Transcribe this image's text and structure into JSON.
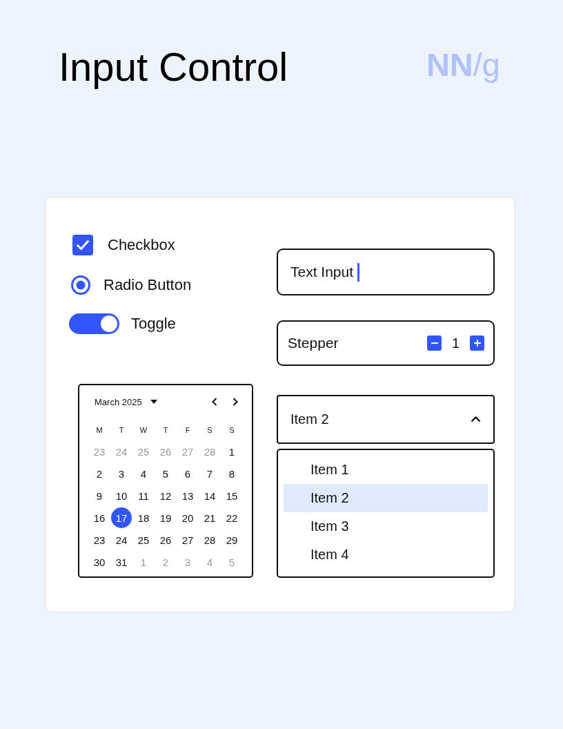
{
  "title": "Input Control",
  "logo": "**NN**/g",
  "checkbox": {
    "label": "Checkbox",
    "checked": true
  },
  "radio": {
    "label": "Radio Button",
    "selected": true
  },
  "toggle": {
    "label": "Toggle",
    "on": true
  },
  "calendar": {
    "month": "March 2025",
    "weekdays": [
      "M",
      "T",
      "W",
      "T",
      "F",
      "S",
      "S"
    ],
    "weeks": [
      [
        {
          "day": "23",
          "muted": true,
          "selected": false
        },
        {
          "day": "24",
          "muted": true,
          "selected": false
        },
        {
          "day": "25",
          "muted": true,
          "selected": false
        },
        {
          "day": "26",
          "muted": true,
          "selected": false
        },
        {
          "day": "27",
          "muted": true,
          "selected": false
        },
        {
          "day": "28",
          "muted": true,
          "selected": false
        },
        {
          "day": "1",
          "muted": false,
          "selected": false
        }
      ],
      [
        {
          "day": "2",
          "muted": false,
          "selected": false
        },
        {
          "day": "3",
          "muted": false,
          "selected": false
        },
        {
          "day": "4",
          "muted": false,
          "selected": false
        },
        {
          "day": "5",
          "muted": false,
          "selected": false
        },
        {
          "day": "6",
          "muted": false,
          "selected": false
        },
        {
          "day": "7",
          "muted": false,
          "selected": false
        },
        {
          "day": "8",
          "muted": false,
          "selected": false
        }
      ],
      [
        {
          "day": "9",
          "muted": false,
          "selected": false
        },
        {
          "day": "10",
          "muted": false,
          "selected": false
        },
        {
          "day": "11",
          "muted": false,
          "selected": false
        },
        {
          "day": "12",
          "muted": false,
          "selected": false
        },
        {
          "day": "13",
          "muted": false,
          "selected": false
        },
        {
          "day": "14",
          "muted": false,
          "selected": false
        },
        {
          "day": "15",
          "muted": false,
          "selected": false
        }
      ],
      [
        {
          "day": "16",
          "muted": false,
          "selected": false
        },
        {
          "day": "17",
          "muted": false,
          "selected": true
        },
        {
          "day": "18",
          "muted": false,
          "selected": false
        },
        {
          "day": "19",
          "muted": false,
          "selected": false
        },
        {
          "day": "20",
          "muted": false,
          "selected": false
        },
        {
          "day": "21",
          "muted": false,
          "selected": false
        },
        {
          "day": "22",
          "muted": false,
          "selected": false
        }
      ],
      [
        {
          "day": "23",
          "muted": false,
          "selected": false
        },
        {
          "day": "24",
          "muted": false,
          "selected": false
        },
        {
          "day": "25",
          "muted": false,
          "selected": false
        },
        {
          "day": "26",
          "muted": false,
          "selected": false
        },
        {
          "day": "27",
          "muted": false,
          "selected": false
        },
        {
          "day": "28",
          "muted": false,
          "selected": false
        },
        {
          "day": "29",
          "muted": false,
          "selected": false
        }
      ],
      [
        {
          "day": "30",
          "muted": false,
          "selected": false
        },
        {
          "day": "31",
          "muted": false,
          "selected": false
        },
        {
          "day": "1",
          "muted": true,
          "selected": false
        },
        {
          "day": "2",
          "muted": true,
          "selected": false
        },
        {
          "day": "3",
          "muted": true,
          "selected": false
        },
        {
          "day": "4",
          "muted": true,
          "selected": false
        },
        {
          "day": "5",
          "muted": true,
          "selected": false
        }
      ]
    ]
  },
  "text_input": {
    "value": "Text Input",
    "focused": true
  },
  "stepper": {
    "label": "Stepper",
    "value": "1"
  },
  "select": {
    "value": "Item 2",
    "expanded": true,
    "options": [
      {
        "label": "Item 1",
        "selected": false
      },
      {
        "label": "Item 2",
        "selected": true
      },
      {
        "label": "Item 3",
        "selected": false
      },
      {
        "label": "Item 4",
        "selected": false
      }
    ]
  }
}
